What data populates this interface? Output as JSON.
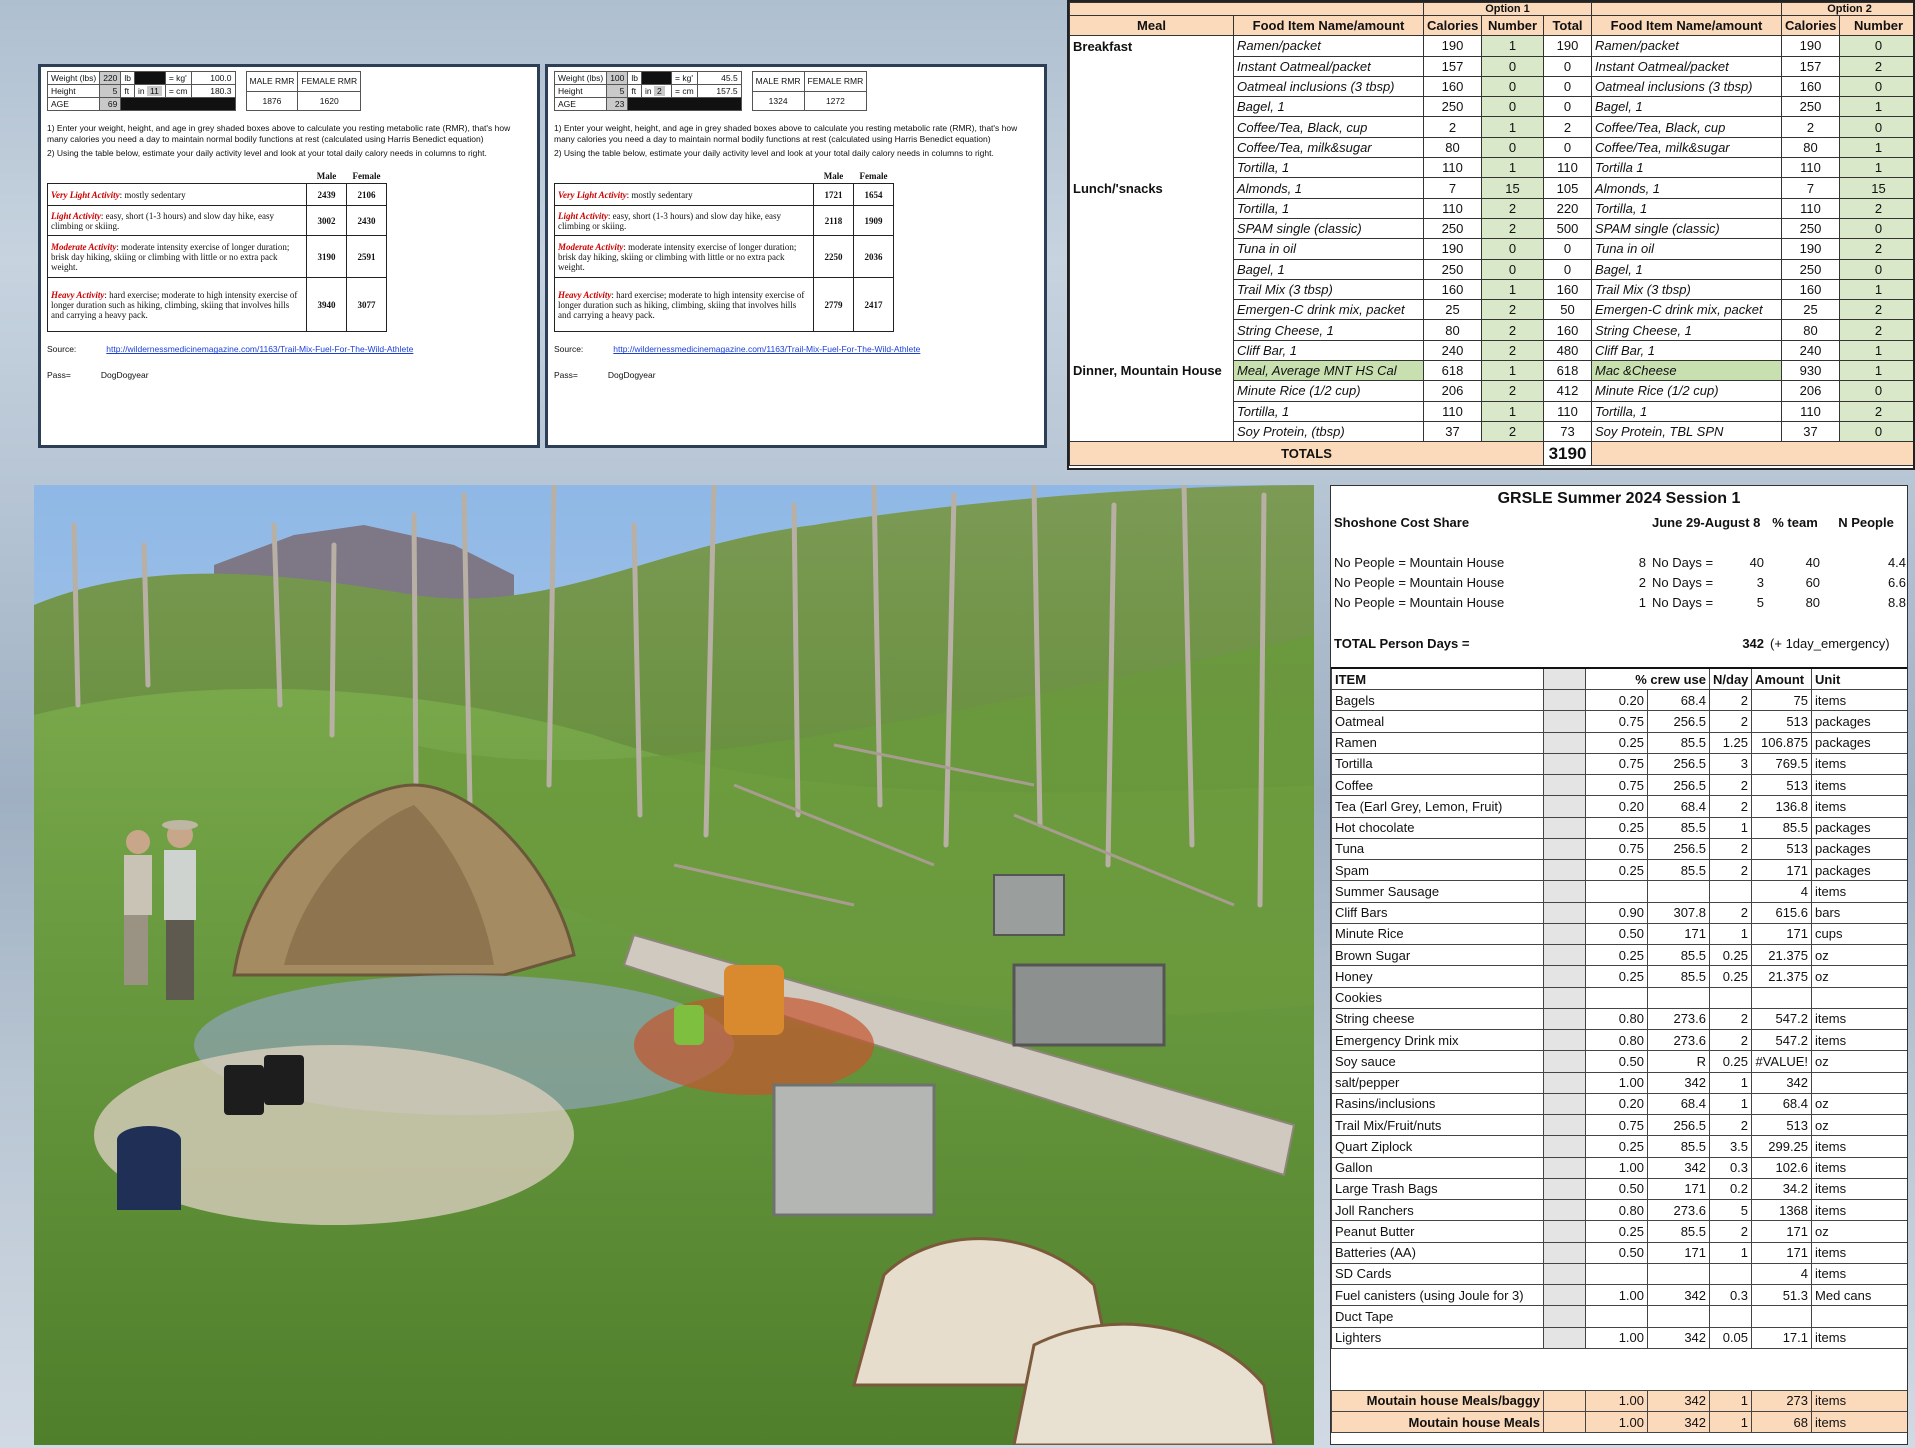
{
  "rmr_sheets": [
    {
      "weight_label": "Weight (lbs)",
      "weight_val": "220",
      "weight_unit": "lb",
      "kg_label": "= kg'",
      "kg_val": "100.0",
      "height_label": "Height",
      "ft_val": "5",
      "ft_unit": "ft",
      "in_unit": "in",
      "in_val": "11",
      "cm_label": "= cm",
      "cm_val": "180.3",
      "age_label": "AGE",
      "age_val": "69",
      "male_rmr_label": "MALE RMR",
      "female_rmr_label": "FEMALE RMR",
      "male_rmr": "1876",
      "female_rmr": "1620",
      "instr1": "1) Enter your weight, height, and age in grey shaded boxes above to calculate you resting metabolic rate (RMR), that's how many calories you need a day to maintain normal bodily functions at rest (calculated using Harris Benedict equation)",
      "instr2": "2) Using the table below, estimate your daily activity level and look at your total daily calory needs in columns to right.",
      "col_male": "Male",
      "col_female": "Female",
      "activities": [
        {
          "label": "Very Light Activity",
          "desc": ": mostly sedentary",
          "male": "2439",
          "female": "2106"
        },
        {
          "label": "Light Activity",
          "desc": ": easy, short (1-3 hours) and slow day hike, easy climbing or skiing.",
          "male": "3002",
          "female": "2430"
        },
        {
          "label": "Moderate Activity",
          "desc": ": moderate intensity exercise of longer duration; brisk day hiking, skiing or climbing with little or no extra pack weight.",
          "male": "3190",
          "female": "2591"
        },
        {
          "label": "Heavy Activity",
          "desc": ": hard exercise; moderate to high intensity exercise of longer duration such as hiking, climbing, skiing that involves hills and carrying a heavy pack.",
          "male": "3940",
          "female": "3077"
        }
      ],
      "source_label": "Source:",
      "source_url": "http://wildernessmedicinemagazine.com/1163/Trail-Mix-Fuel-For-The-Wild-Athlete",
      "pass_label": "Pass=",
      "pass_val": "DogDogyear"
    },
    {
      "weight_label": "Weight (lbs)",
      "weight_val": "100",
      "weight_unit": "lb",
      "kg_label": "= kg'",
      "kg_val": "45.5",
      "height_label": "Height",
      "ft_val": "5",
      "ft_unit": "ft",
      "in_unit": "in",
      "in_val": "2",
      "cm_label": "= cm",
      "cm_val": "157.5",
      "age_label": "AGE",
      "age_val": "23",
      "male_rmr_label": "MALE RMR",
      "female_rmr_label": "FEMALE RMR",
      "male_rmr": "1324",
      "female_rmr": "1272",
      "instr1": "1) Enter your weight, height, and age in grey shaded boxes above to calculate you resting metabolic rate (RMR), that's how many calories you need a day to maintain normal bodily functions at rest (calculated using Harris Benedict equation)",
      "instr2": "2) Using the table below, estimate your daily activity level and look at your total daily calory needs in columns to right.",
      "col_male": "Male",
      "col_female": "Female",
      "activities": [
        {
          "label": "Very Light Activity",
          "desc": ": mostly sedentary",
          "male": "1721",
          "female": "1654"
        },
        {
          "label": "Light Activity",
          "desc": ": easy, short (1-3 hours) and slow day hike, easy climbing or skiing.",
          "male": "2118",
          "female": "1909"
        },
        {
          "label": "Moderate Activity",
          "desc": ": moderate intensity exercise of longer duration; brisk day hiking, skiing or climbing with little or no extra pack weight.",
          "male": "2250",
          "female": "2036"
        },
        {
          "label": "Heavy Activity",
          "desc": ": hard exercise; moderate to high intensity exercise of longer duration such as hiking, climbing, skiing that involves hills and carrying a heavy pack.",
          "male": "2779",
          "female": "2417"
        }
      ],
      "source_label": "Source:",
      "source_url": "http://wildernessmedicinemagazine.com/1163/Trail-Mix-Fuel-For-The-Wild-Athlete",
      "pass_label": "Pass=",
      "pass_val": "DogDogyear"
    }
  ],
  "menu": {
    "option1": "Option 1",
    "option2": "Option 2",
    "headers": [
      "Meal",
      "Food Item Name/amount",
      "Calories",
      "Number",
      "Total",
      "Food Item Name/amount",
      "Calories",
      "Number"
    ],
    "rows": [
      {
        "meal": "Breakfast",
        "item": "Ramen/packet",
        "cal": "190",
        "num": "1",
        "total": "190",
        "item2": "Ramen/packet",
        "cal2": "190",
        "num2": "0"
      },
      {
        "meal": "",
        "item": "Instant Oatmeal/packet",
        "cal": "157",
        "num": "0",
        "total": "0",
        "item2": "Instant Oatmeal/packet",
        "cal2": "157",
        "num2": "2"
      },
      {
        "meal": "",
        "item": "Oatmeal inclusions (3 tbsp)",
        "cal": "160",
        "num": "0",
        "total": "0",
        "item2": "Oatmeal inclusions (3 tbsp)",
        "cal2": "160",
        "num2": "0"
      },
      {
        "meal": "",
        "item": "Bagel, 1",
        "cal": "250",
        "num": "0",
        "total": "0",
        "item2": "Bagel, 1",
        "cal2": "250",
        "num2": "1"
      },
      {
        "meal": "",
        "item": "Coffee/Tea, Black, cup",
        "cal": "2",
        "num": "1",
        "total": "2",
        "item2": "Coffee/Tea, Black, cup",
        "cal2": "2",
        "num2": "0"
      },
      {
        "meal": "",
        "item": "Coffee/Tea, milk&sugar",
        "cal": "80",
        "num": "0",
        "total": "0",
        "item2": "Coffee/Tea, milk&sugar",
        "cal2": "80",
        "num2": "1"
      },
      {
        "meal": "",
        "item": "Tortilla, 1",
        "cal": "110",
        "num": "1",
        "total": "110",
        "item2": "Tortilla 1",
        "cal2": "110",
        "num2": "1"
      },
      {
        "meal": "Lunch/'snacks",
        "item": "Almonds, 1",
        "cal": "7",
        "num": "15",
        "total": "105",
        "item2": "Almonds, 1",
        "cal2": "7",
        "num2": "15"
      },
      {
        "meal": "",
        "item": "Tortilla, 1",
        "cal": "110",
        "num": "2",
        "total": "220",
        "item2": "Tortilla, 1",
        "cal2": "110",
        "num2": "2"
      },
      {
        "meal": "",
        "item": "SPAM single (classic)",
        "cal": "250",
        "num": "2",
        "total": "500",
        "item2": "SPAM single (classic)",
        "cal2": "250",
        "num2": "0"
      },
      {
        "meal": "",
        "item": "Tuna in oil",
        "cal": "190",
        "num": "0",
        "total": "0",
        "item2": "Tuna in oil",
        "cal2": "190",
        "num2": "2"
      },
      {
        "meal": "",
        "item": "Bagel, 1",
        "cal": "250",
        "num": "0",
        "total": "0",
        "item2": "Bagel, 1",
        "cal2": "250",
        "num2": "0"
      },
      {
        "meal": "",
        "item": "Trail Mix (3 tbsp)",
        "cal": "160",
        "num": "1",
        "total": "160",
        "item2": "Trail Mix (3 tbsp)",
        "cal2": "160",
        "num2": "1"
      },
      {
        "meal": "",
        "item": "Emergen-C drink mix, packet",
        "cal": "25",
        "num": "2",
        "total": "50",
        "item2": "Emergen-C drink mix, packet",
        "cal2": "25",
        "num2": "2"
      },
      {
        "meal": "",
        "item": "String Cheese, 1",
        "cal": "80",
        "num": "2",
        "total": "160",
        "item2": "String Cheese, 1",
        "cal2": "80",
        "num2": "2"
      },
      {
        "meal": "",
        "item": "Cliff Bar, 1",
        "cal": "240",
        "num": "2",
        "total": "480",
        "item2": "Cliff Bar, 1",
        "cal2": "240",
        "num2": "1"
      },
      {
        "meal": "Dinner, Mountain House",
        "item": "Meal, Average MNT HS Cal",
        "cal": "618",
        "num": "1",
        "total": "618",
        "item2": "Mac &Cheese",
        "cal2": "930",
        "num2": "1",
        "hl": true
      },
      {
        "meal": "",
        "item": "Minute Rice (1/2 cup)",
        "cal": "206",
        "num": "2",
        "total": "412",
        "item2": "Minute Rice (1/2 cup)",
        "cal2": "206",
        "num2": "0"
      },
      {
        "meal": "",
        "item": "Tortilla, 1",
        "cal": "110",
        "num": "1",
        "total": "110",
        "item2": "Tortilla, 1",
        "cal2": "110",
        "num2": "2"
      },
      {
        "meal": "",
        "item": "Soy Protein, (tbsp)",
        "cal": "37",
        "num": "2",
        "total": "73",
        "item2": "Soy Protein, TBL SPN",
        "cal2": "37",
        "num2": "0"
      }
    ],
    "totals_label": "TOTALS",
    "totals_val": "3190"
  },
  "cost": {
    "title": "GRSLE Summer 2024 Session 1",
    "subtitle": "Shoshone Cost Share",
    "dates": "June 29-August 8",
    "pct_team_label": "% team",
    "n_people_label": "N People",
    "people_rows": [
      {
        "n": "8",
        "label": "No People = Mountain House",
        "days_label": "No Days =",
        "days": "40",
        "pct": "40",
        "np": "4.4"
      },
      {
        "n": "2",
        "label": "No People = Mountain House",
        "days_label": "No Days =",
        "days": "3",
        "pct": "60",
        "np": "6.6"
      },
      {
        "n": "1",
        "label": "No People = Mountain House",
        "days_label": "No Days =",
        "days": "5",
        "pct": "80",
        "np": "8.8"
      }
    ],
    "total_label": "TOTAL Person Days =",
    "total_val": "342",
    "total_note": "(+ 1day_emergency)",
    "headers": [
      "ITEM",
      "% crew use",
      "N/day",
      "Amount",
      "Unit"
    ],
    "items": [
      [
        "Bagels",
        "0.20",
        "68.4",
        "2",
        "75",
        "items"
      ],
      [
        "Oatmeal",
        "0.75",
        "256.5",
        "2",
        "513",
        "packages"
      ],
      [
        "Ramen",
        "0.25",
        "85.5",
        "1.25",
        "106.875",
        "packages"
      ],
      [
        "Tortilla",
        "0.75",
        "256.5",
        "3",
        "769.5",
        "items"
      ],
      [
        "Coffee",
        "0.75",
        "256.5",
        "2",
        "513",
        "items"
      ],
      [
        "Tea (Earl Grey, Lemon, Fruit)",
        "0.20",
        "68.4",
        "2",
        "136.8",
        "items"
      ],
      [
        "Hot chocolate",
        "0.25",
        "85.5",
        "1",
        "85.5",
        "packages"
      ],
      [
        "Tuna",
        "0.75",
        "256.5",
        "2",
        "513",
        "packages"
      ],
      [
        "Spam",
        "0.25",
        "85.5",
        "2",
        "171",
        "packages"
      ],
      [
        "Summer Sausage",
        "",
        "",
        "",
        "4",
        "items"
      ],
      [
        "Cliff Bars",
        "0.90",
        "307.8",
        "2",
        "615.6",
        "bars"
      ],
      [
        "Minute Rice",
        "0.50",
        "171",
        "1",
        "171",
        "cups"
      ],
      [
        "Brown Sugar",
        "0.25",
        "85.5",
        "0.25",
        "21.375",
        "oz"
      ],
      [
        "Honey",
        "0.25",
        "85.5",
        "0.25",
        "21.375",
        "oz"
      ],
      [
        "Cookies",
        "",
        "",
        "",
        "",
        ""
      ],
      [
        "String cheese",
        "0.80",
        "273.6",
        "2",
        "547.2",
        "items"
      ],
      [
        "Emergency Drink mix",
        "0.80",
        "273.6",
        "2",
        "547.2",
        "items"
      ],
      [
        "Soy sauce",
        "0.50",
        "R",
        "0.25",
        "#VALUE!",
        "oz"
      ],
      [
        "salt/pepper",
        "1.00",
        "342",
        "1",
        "342",
        ""
      ],
      [
        "Rasins/inclusions",
        "0.20",
        "68.4",
        "1",
        "68.4",
        "oz"
      ],
      [
        "Trail Mix/Fruit/nuts",
        "0.75",
        "256.5",
        "2",
        "513",
        "oz"
      ],
      [
        "Quart Ziplock",
        "0.25",
        "85.5",
        "3.5",
        "299.25",
        "items"
      ],
      [
        "Gallon",
        "1.00",
        "342",
        "0.3",
        "102.6",
        "items"
      ],
      [
        "Large Trash Bags",
        "0.50",
        "171",
        "0.2",
        "34.2",
        "items"
      ],
      [
        "Joll Ranchers",
        "0.80",
        "273.6",
        "5",
        "1368",
        "items"
      ],
      [
        "Peanut Butter",
        "0.25",
        "85.5",
        "2",
        "171",
        "oz"
      ],
      [
        "Batteries (AA)",
        "0.50",
        "171",
        "1",
        "171",
        "items"
      ],
      [
        "SD Cards",
        "",
        "",
        "",
        "4",
        "items"
      ],
      [
        "Fuel canisters (using Joule for 3)",
        "1.00",
        "342",
        "0.3",
        "51.3",
        "Med cans"
      ],
      [
        "Duct Tape",
        "",
        "",
        "",
        "",
        ""
      ],
      [
        "Lighters",
        "1.00",
        "342",
        "0.05",
        "17.1",
        "items"
      ]
    ],
    "footer": [
      [
        "Moutain house Meals/baggy",
        "1.00",
        "342",
        "1",
        "273",
        "items"
      ],
      [
        "Moutain house Meals",
        "1.00",
        "342",
        "1",
        "68",
        "items"
      ]
    ]
  },
  "colors": {
    "header_orange": "#fbd9bb",
    "number_green": "#d8e8c8",
    "activity_red": "#cc0000",
    "link_blue": "#1a3fd8"
  }
}
